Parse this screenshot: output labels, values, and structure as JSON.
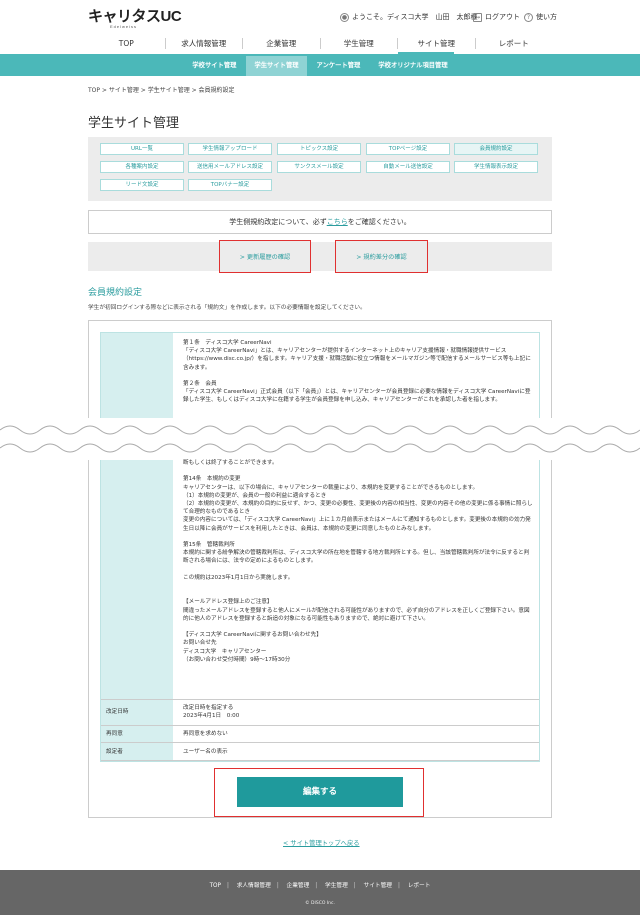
{
  "header": {
    "logo": "キャリタスUC",
    "logo_sub": "Edelweiss",
    "welcome": "ようこそ。ディスコ大学　山田　太郎様",
    "logout": "ログアウト",
    "help": "使い方"
  },
  "gnav": [
    "TOP",
    "求人情報管理",
    "企業管理",
    "学生管理",
    "サイト管理",
    "レポート"
  ],
  "snav": [
    "学校サイト管理",
    "学生サイト管理",
    "アンケート管理",
    "学校オリジナル項目管理"
  ],
  "breadcrumb": "TOP > サイト管理 > 学生サイト管理 > 会員規約設定",
  "page_title": "学生サイト管理",
  "tabs": [
    "URL一覧",
    "学生情報アップロード",
    "トピックス設定",
    "TOPページ設定",
    "会員規約設定",
    "各種案内設定",
    "送信用メールアドレス設定",
    "サンクスメール設定",
    "自動メール送信設定",
    "学生情報表示設定",
    "リード文設定",
    "TOPバナー設定"
  ],
  "notice": {
    "prefix": "学生側規約改定について、必ず",
    "link": "こちら",
    "suffix": "をご確認ください。"
  },
  "links": {
    "history": "> 更新履歴の確認",
    "diff": "> 規約差分の確認"
  },
  "section": {
    "title": "会員規約設定",
    "desc": "学生が初回ログインする際などに表示される「規約文」を作成します。以下の必要情報を設定してください。"
  },
  "terms_top": "第１条　ディスコ大学 CareerNavi\n「ディスコ大学 CareerNavi」とは、キャリアセンターが提供するインターネット上のキャリア支援情報・就職情報提供サービス（https://www.disc.co.jp/）を指します。キャリア支援・就職活動に役立つ情報をメールマガジン等で配信するメールサービス等も上記に含みます。\n\n第２条　会員\n「ディスコ大学 CareerNavi」正式会員（以下「会員」）とは、キャリアセンターが会員登録に必要な情報をディスコ大学 CareerNaviに登録した学生、もしくはディスコ大学に在籍する学生が会員登録を申し込み、キャリアセンターがこれを承認した者を指します。",
  "terms_bottom": "断もしくは終了することができます。\n\n第14条　本規約の変更\nキャリアセンターは、以下の場合に、キャリアセンターの裁量により、本規約を変更することができるものとします。\n（1）本規約の変更が、会員の一般の利益に適合するとき\n（2）本規約の変更が、本規約の目的に反せず、かつ、変更の必要性、変更後の内容の相当性、変更の内容その他の変更に係る事情に照らして合理的なものであるとき\n変更の内容については、「ディスコ大学 CareerNavi」上に１カ月前表示またはメールにて通知するものとします。変更後の本規約の効力発生日以降に会員がサービスを利用したときは、会員は、本規約の変更に同意したものとみなします。\n\n第15条　管轄裁判所\n本規約に関する紛争解決の管轄裁判所は、ディスコ大学の所在地を管轄する地方裁判所とする。但し、当該管轄裁判所が法令に反すると判断される場合には、法令の定めによるものとします。\n\nこの規約は2023年1月1日から実施します。\n\n\n【メールアドレス登録上のご注意】\n間違ったメールアドレスを登録すると他人にメールが配信される可能性がありますので、必ず自分のアドレスを正しくご登録下さい。意図的に他人のアドレスを登録すると訴追の対象になる可能性もありますので、絶対に避けて下さい。\n\n【ディスコ大学 CareerNaviに関するお問い合わせ先】\nお問い合せ先\nディスコ大学　キャリアセンター\n（お問い合わせ受付時間）9時〜17時30分",
  "rows": [
    {
      "k": "改定日時",
      "v1": "改定日時を指定する",
      "v2": "2023年4月1日　0:00"
    },
    {
      "k": "再同意",
      "v1": "再同意を求めない"
    },
    {
      "k": "設定者",
      "v1": "ユーザー名の表示"
    }
  ],
  "edit_button": "編集する",
  "back_link": "< サイト管理トップへ戻る",
  "footer": {
    "nav": [
      "TOP",
      "求人情報管理",
      "企業管理",
      "学生管理",
      "サイト管理",
      "レポート"
    ],
    "copy": "© DISCO Inc."
  }
}
